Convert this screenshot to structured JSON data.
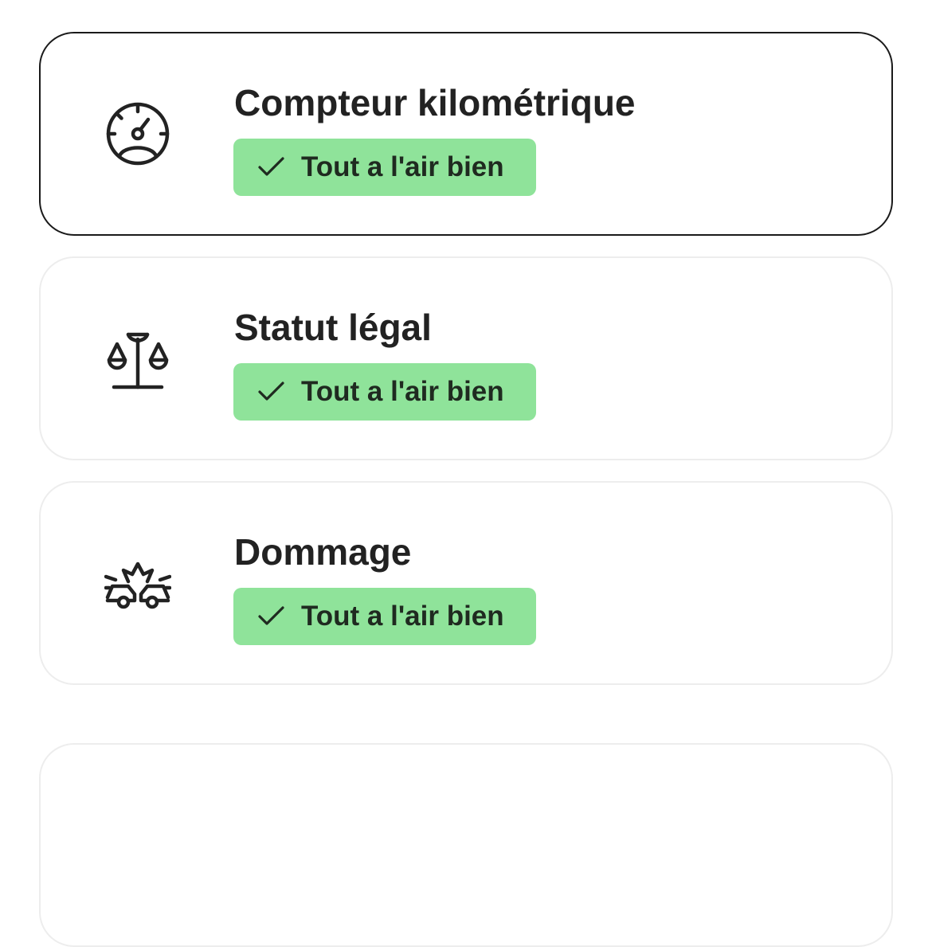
{
  "checks": [
    {
      "title": "Compteur kilométrique",
      "icon": "speedometer-icon",
      "status_label": "Tout a l'air bien",
      "status_icon": "checkmark-icon",
      "selected": true
    },
    {
      "title": "Statut légal",
      "icon": "scales-of-justice-icon",
      "status_label": "Tout a l'air bien",
      "status_icon": "checkmark-icon",
      "selected": false
    },
    {
      "title": "Dommage",
      "icon": "car-collision-icon",
      "status_label": "Tout a l'air bien",
      "status_icon": "checkmark-icon",
      "selected": false
    }
  ],
  "colors": {
    "badge_background": "#8fe39a",
    "selected_border": "#1a1a1a",
    "card_border": "#ededed",
    "text": "#222222"
  }
}
